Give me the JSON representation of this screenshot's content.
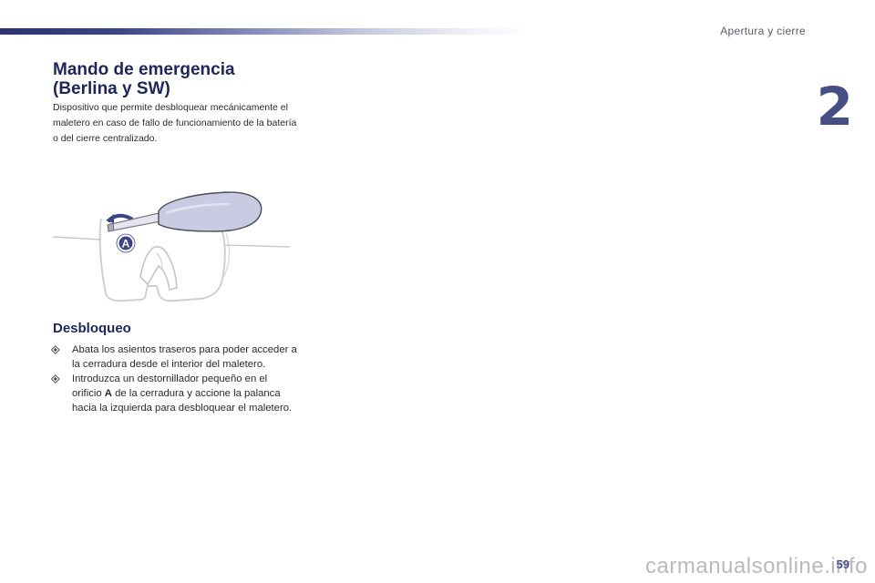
{
  "header": {
    "section_title": "Apertura y cierre",
    "chapter_number": "2"
  },
  "content": {
    "title_line1": "Mando de emergencia",
    "title_line2": "(Berlina y SW)",
    "intro": "Dispositivo que permite desbloquear mecánicamente el maletero en caso de fallo de funcionamiento de la batería o del cierre centralizado.",
    "illustration_label": "A",
    "subheading": "Desbloqueo",
    "steps": [
      {
        "text": "Abata los asientos traseros para poder acceder a la cerradura desde el interior del maletero."
      },
      {
        "before": "Introduzca un destornillador pequeño en el orificio ",
        "bold": "A",
        "after": " de la cerradura y accione la palanca hacia la izquierda para desbloquear el maletero."
      }
    ]
  },
  "footer": {
    "page_number": "59",
    "watermark": "carmanualsonline.info"
  },
  "colors": {
    "accent": "#1e2658",
    "chapter": "#454f86",
    "tool": "#c9cbe2"
  },
  "icons": [
    "step-bullet-icon",
    "screwdriver-icon",
    "callout-a-icon"
  ]
}
